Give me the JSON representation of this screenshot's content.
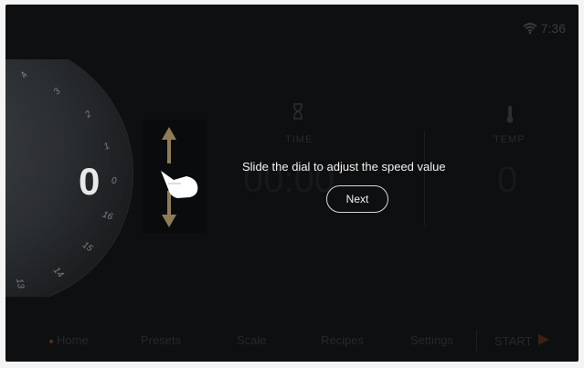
{
  "status": {
    "time": "7:36",
    "wifi_icon": "wifi-icon"
  },
  "dial": {
    "value": "0",
    "ticks": [
      "4",
      "3",
      "2",
      "1",
      "0",
      "16",
      "15",
      "14",
      "13"
    ]
  },
  "panels": {
    "time": {
      "title": "TIME",
      "value": "00:00",
      "icon": "hourglass-icon"
    },
    "temp": {
      "title": "TEMP",
      "value": "0",
      "icon": "thermometer-icon"
    }
  },
  "overlay": {
    "message": "Slide the dial to adjust the speed value",
    "next_label": "Next"
  },
  "nav": {
    "home": "Home",
    "presets": "Presets",
    "scale": "Scale",
    "recipes": "Recipes",
    "settings": "Settings",
    "start": "START"
  },
  "colors": {
    "screen_bg": "#0e0f10",
    "arrow": "#8e7c59",
    "accent": "#5a2d18"
  }
}
